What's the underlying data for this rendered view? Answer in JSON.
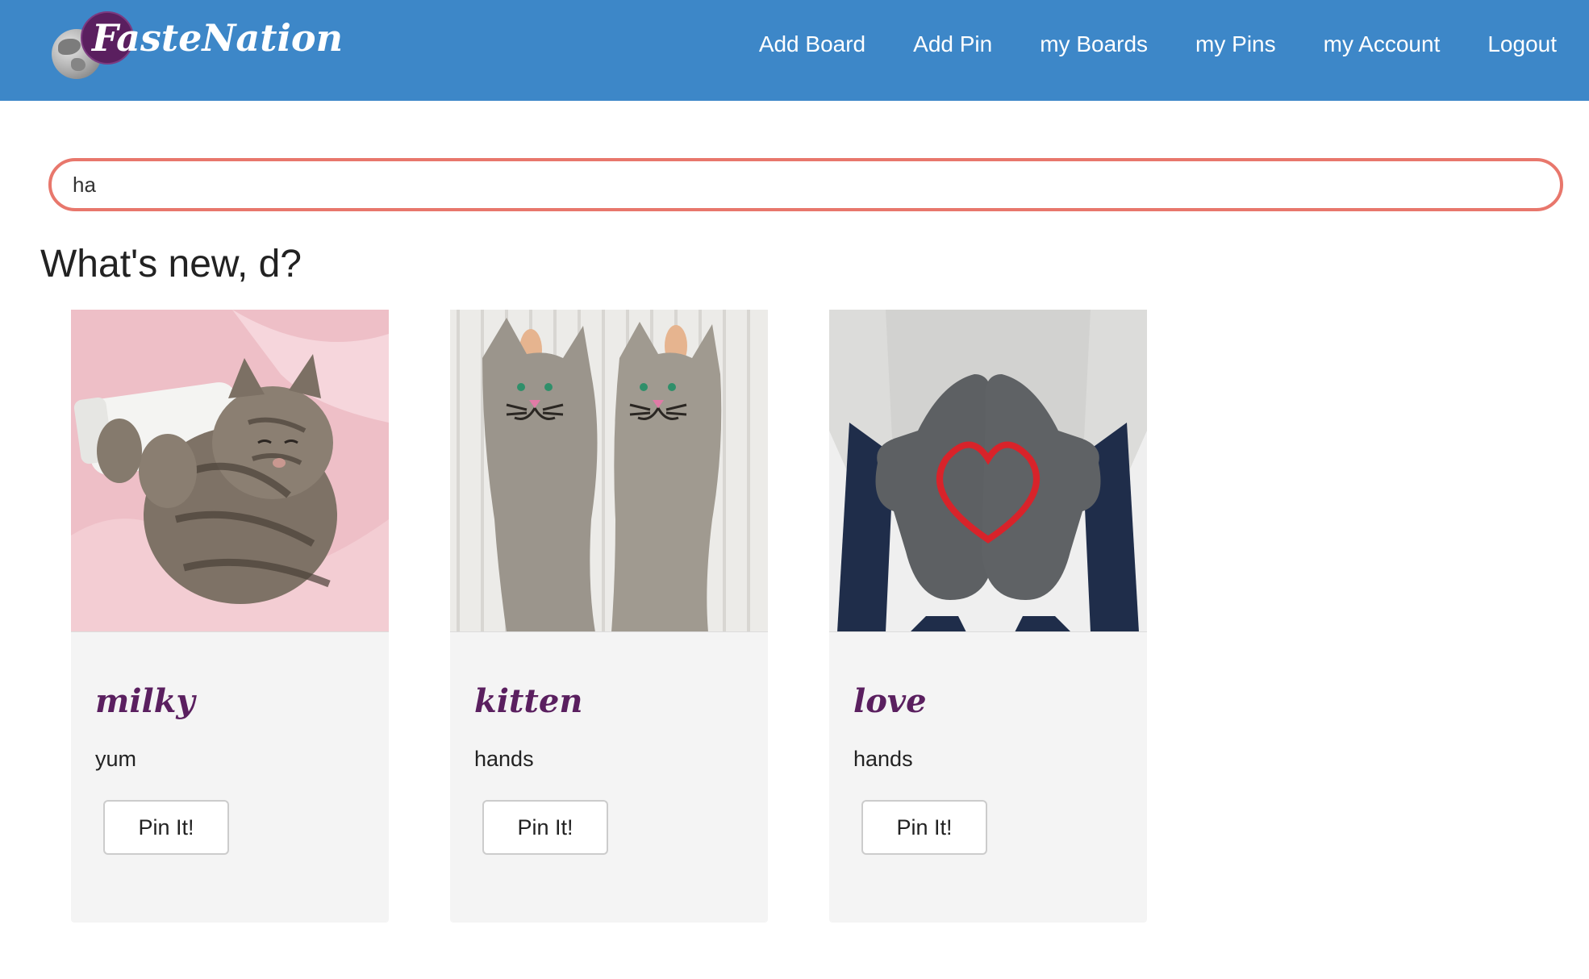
{
  "brand": {
    "name": "FasteNation"
  },
  "nav": {
    "items": [
      {
        "label": "Add Board"
      },
      {
        "label": "Add Pin"
      },
      {
        "label": "my Boards"
      },
      {
        "label": "my Pins"
      },
      {
        "label": "my Account"
      },
      {
        "label": "Logout"
      }
    ]
  },
  "search": {
    "value": "ha"
  },
  "heading": "What's new, d?",
  "cards": [
    {
      "title": "milky",
      "description": "yum",
      "button_label": "Pin It!",
      "image": "kitten-drinking-bottle"
    },
    {
      "title": "kitten",
      "description": "hands",
      "button_label": "Pin It!",
      "image": "crochet-cat-gloves"
    },
    {
      "title": "love",
      "description": "hands",
      "button_label": "Pin It!",
      "image": "crochet-heart-mittens"
    }
  ],
  "colors": {
    "navbar": "#3d87c8",
    "search_border": "#e8776c",
    "card_title": "#5a1f5f",
    "card_bg": "#f4f4f4"
  }
}
